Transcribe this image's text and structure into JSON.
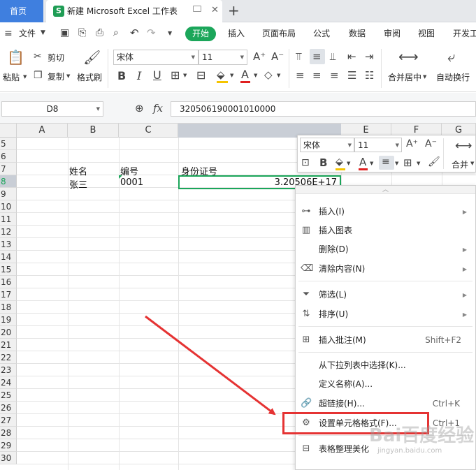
{
  "tabs": {
    "home": "首页",
    "doc_logo": "S",
    "doc_title": "新建 Microsoft Excel 工作表",
    "new_tab": "+",
    "close": "✕"
  },
  "menu": {
    "file": "文件",
    "items": [
      "开始",
      "插入",
      "页面布局",
      "公式",
      "数据",
      "审阅",
      "视图",
      "开发工"
    ]
  },
  "ribbon": {
    "paste": "粘贴",
    "cut": "剪切",
    "copy": "复制",
    "format_painter": "格式刷",
    "font_name": "宋体",
    "font_size": "11",
    "merge_center": "合并居中",
    "wrap_text": "自动换行"
  },
  "formula_bar": {
    "name_box": "D8",
    "fx_label": "fx",
    "value": "320506190001010000"
  },
  "grid": {
    "columns": [
      "A",
      "B",
      "C",
      "D",
      "E",
      "F",
      "G"
    ],
    "rows": [
      "5",
      "6",
      "7",
      "8",
      "9",
      "10",
      "11",
      "12",
      "13",
      "14",
      "15",
      "16",
      "17",
      "18",
      "19",
      "20",
      "21",
      "22",
      "23",
      "24",
      "25",
      "26",
      "27",
      "28",
      "29",
      "30"
    ],
    "header_name": "姓名",
    "header_id": "编号",
    "header_idcard": "身份证号",
    "val_name": "张三",
    "val_id": "0001",
    "val_idcard": "3.20506E+17"
  },
  "mini_toolbar": {
    "font_name": "宋体",
    "font_size": "11",
    "merge": "合并"
  },
  "context_menu": {
    "items": [
      {
        "label": "插入(I)",
        "icon": "insert-icon"
      },
      {
        "label": "插入图表",
        "icon": "chart-icon"
      },
      {
        "label": "删除(D)",
        "icon": ""
      },
      {
        "label": "清除内容(N)",
        "icon": "eraser-icon"
      },
      {
        "label": "筛选(L)",
        "icon": "filter-icon"
      },
      {
        "label": "排序(U)",
        "icon": "sort-icon"
      },
      {
        "label": "插入批注(M)",
        "icon": "comment-icon",
        "shortcut": "Shift+F2"
      },
      {
        "label": "从下拉列表中选择(K)...",
        "icon": ""
      },
      {
        "label": "定义名称(A)...",
        "icon": ""
      },
      {
        "label": "超链接(H)...",
        "icon": "link-icon",
        "shortcut": "Ctrl+K"
      },
      {
        "label": "设置单元格格式(F)...",
        "icon": "format-cells-icon",
        "shortcut": "Ctrl+1"
      },
      {
        "label": "表格整理美化",
        "icon": "beautify-icon"
      }
    ]
  },
  "watermark": {
    "text": "Bai百度经验",
    "url": "jingyan.baidu.com"
  }
}
